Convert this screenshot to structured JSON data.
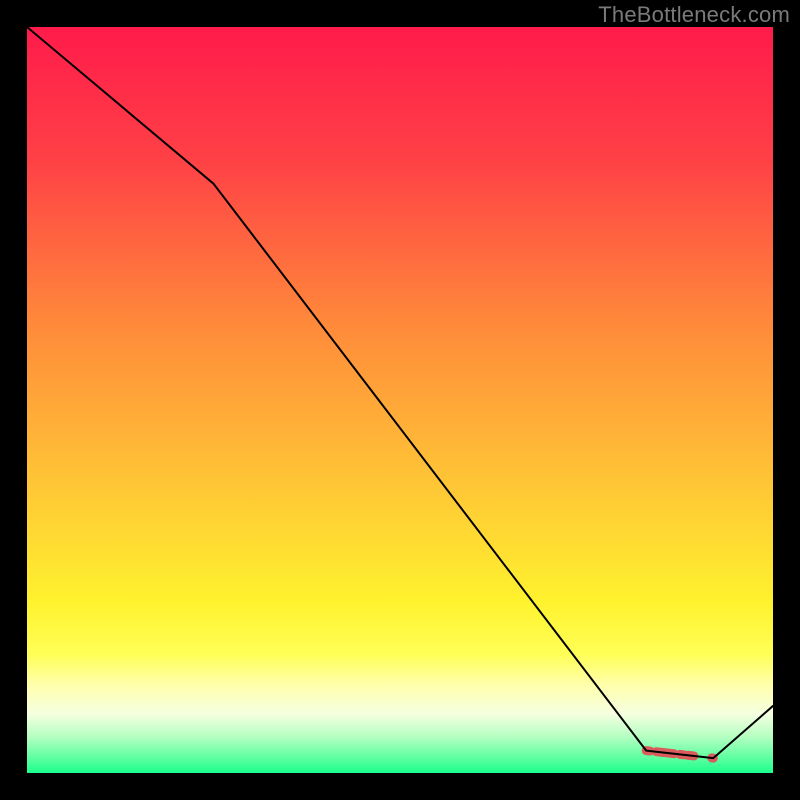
{
  "watermark": "TheBottleneck.com",
  "chart_data": {
    "type": "line",
    "title": "",
    "xlabel": "",
    "ylabel": "",
    "xlim": [
      0,
      100
    ],
    "ylim": [
      0,
      100
    ],
    "grid": false,
    "series": [
      {
        "name": "curve",
        "x": [
          0,
          25,
          83,
          92,
          100
        ],
        "y": [
          100,
          79,
          3,
          2,
          9
        ],
        "stroke": "#000000",
        "width": 2
      }
    ],
    "highlight_segment": {
      "x": [
        83,
        92
      ],
      "y": [
        3,
        2
      ],
      "stroke": "#d95b5b",
      "width": 9
    },
    "background_gradient_stops": [
      {
        "pct": 0,
        "color": "#ff1b4b"
      },
      {
        "pct": 18,
        "color": "#ff4146"
      },
      {
        "pct": 40,
        "color": "#ff8a3a"
      },
      {
        "pct": 60,
        "color": "#ffc236"
      },
      {
        "pct": 77,
        "color": "#fff22e"
      },
      {
        "pct": 84,
        "color": "#ffff55"
      },
      {
        "pct": 88,
        "color": "#ffffa8"
      },
      {
        "pct": 92,
        "color": "#f6ffe0"
      },
      {
        "pct": 95,
        "color": "#b8ffc4"
      },
      {
        "pct": 98,
        "color": "#5effa0"
      },
      {
        "pct": 100,
        "color": "#1aff8c"
      }
    ]
  }
}
